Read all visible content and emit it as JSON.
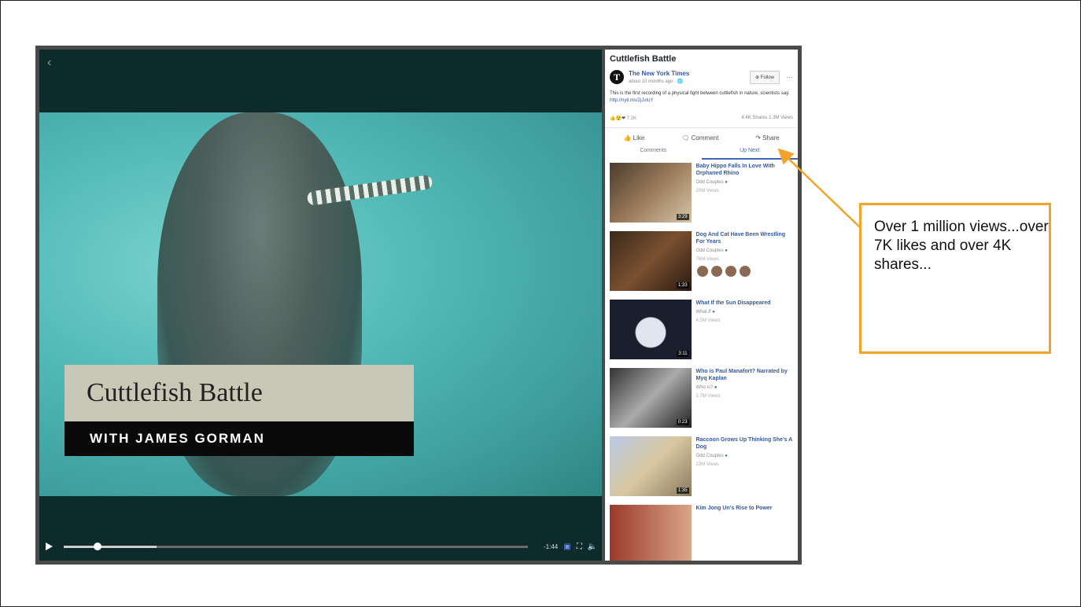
{
  "player": {
    "back_icon": "chevron-left-icon",
    "caption_title": "Cuttlefish Battle",
    "caption_subtitle": "WITH JAMES GORMAN",
    "time_remaining": "-1:44",
    "progress": 0.2
  },
  "post": {
    "title": "Cuttlefish Battle",
    "publisher": "The New York Times",
    "time": "about 10 months ago · ",
    "follow_label": "Follow",
    "description": "This is the first recording of a physical fight between cuttlefish in nature, scientists say.",
    "link": "http://nyti.ms/2jJvIuY",
    "reactions": "7.2K",
    "shares": "4.4K Shares",
    "views": "1.3M Views",
    "actions": {
      "like": "Like",
      "comment": "Comment",
      "share": "Share"
    },
    "tabs": {
      "comments": "Comments",
      "up_next": "Up Next"
    }
  },
  "up_next": [
    {
      "title": "Baby Hippo Falls In Love With Orphaned Rhino",
      "channel": "Odd Couples",
      "views": "20M Views",
      "duration": "3:29"
    },
    {
      "title": "Dog And Cat Have Been Wrestling For Years",
      "channel": "Odd Couples",
      "views": "76M Views",
      "duration": "1:33"
    },
    {
      "title": "What If the Sun Disappeared",
      "channel": "What.If",
      "views": "4.5M Views",
      "duration": "3:11"
    },
    {
      "title": "Who is Paul Manafort? Narrated by Myq Kaplan",
      "channel": "Who is?",
      "views": "2.7M Views",
      "duration": "0:23"
    },
    {
      "title": "Raccoon Grows Up Thinking She's A Dog",
      "channel": "Odd Couples",
      "views": "23M Views",
      "duration": "1:35"
    },
    {
      "title": "Kim Jong Un's Rise to Power",
      "channel": "",
      "views": "",
      "duration": ""
    }
  ],
  "annotation": {
    "text": "Over 1 million views...over 7K likes and over 4K shares...",
    "color": "#f4a32a"
  }
}
